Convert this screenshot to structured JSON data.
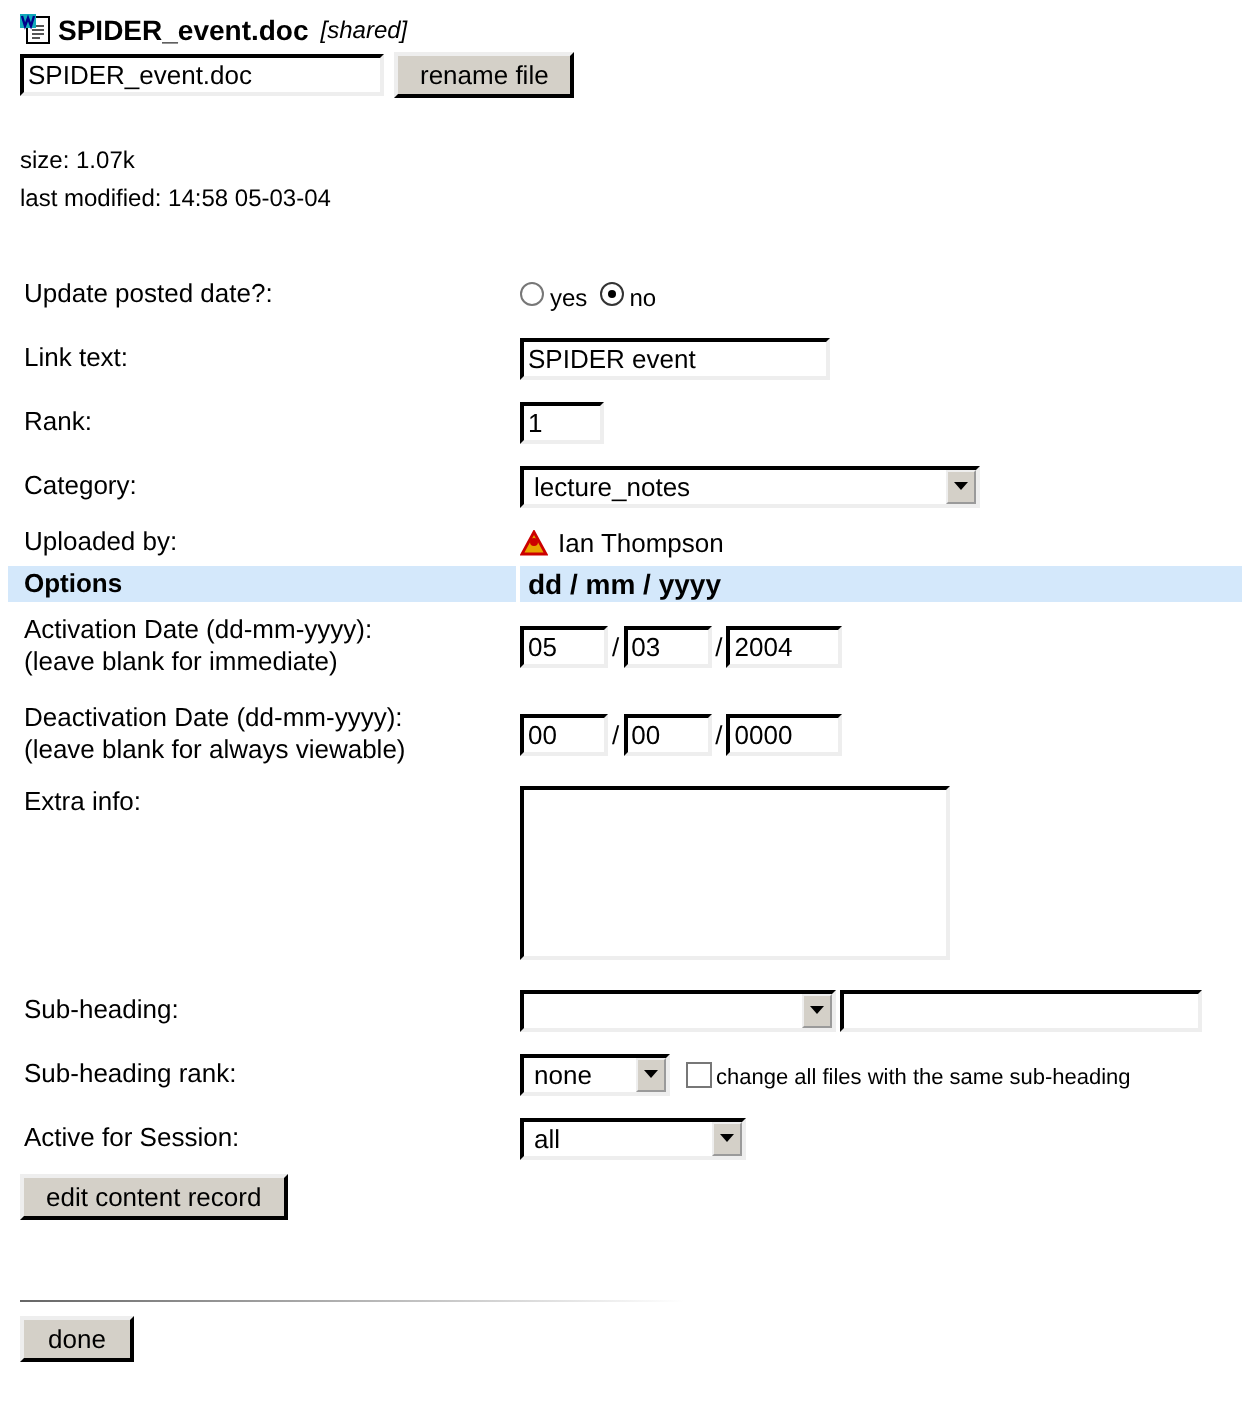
{
  "file": {
    "title": "SPIDER_event.doc",
    "tag": "[shared]",
    "name_value": "SPIDER_event.doc",
    "rename_button": "rename file"
  },
  "info": [
    "size: 1.07k",
    "last modified: 14:58 05-03-04"
  ],
  "rows": [
    {
      "kind": "radio",
      "label": "Update posted date?:",
      "options": [
        {
          "label": "yes",
          "selected": false
        },
        {
          "label": "no",
          "selected": true
        }
      ]
    },
    {
      "kind": "text",
      "label": "Link text:",
      "value": "SPIDER event"
    },
    {
      "kind": "text",
      "label": "Rank:",
      "value": "1"
    },
    {
      "kind": "select",
      "label": "Category:",
      "value": "lecture_notes"
    },
    {
      "kind": "user",
      "label": "Uploaded by:",
      "value": "Ian Thompson"
    },
    {
      "kind": "header",
      "label": "Options",
      "value": "dd / mm / yyyy"
    },
    {
      "kind": "date",
      "label": "Activation Date (dd-mm-yyyy):",
      "hint": "(leave blank for immediate)",
      "parts": [
        "05",
        "03",
        "2004"
      ],
      "separator": "/"
    },
    {
      "kind": "date",
      "label": "Deactivation Date (dd-mm-yyyy):",
      "hint": "(leave blank for always viewable)",
      "parts": [
        "00",
        "00",
        "0000"
      ],
      "separator": "/"
    },
    {
      "kind": "textarea",
      "label": "Extra info:"
    },
    {
      "kind": "combo",
      "label": "Sub-heading:"
    },
    {
      "kind": "rank",
      "label": "Sub-heading rank:",
      "value": "none",
      "checkbox": {
        "label": "change all files with the same sub-heading",
        "checked": false
      }
    },
    {
      "kind": "select",
      "label": "Active for Session:",
      "value": "all"
    }
  ],
  "edit_button": "edit content record",
  "done_button": "done"
}
